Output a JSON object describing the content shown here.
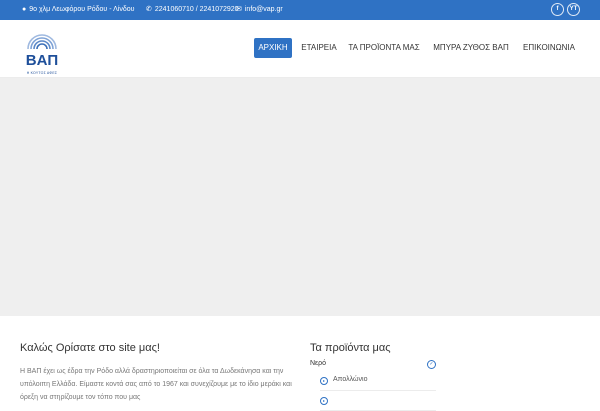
{
  "topbar": {
    "address": "9ο χλμ Λεωφόρου Ρόδου - Λίνδου",
    "phones": "2241060710 / 2241072920",
    "email": "info@vap.gr",
    "social": [
      {
        "icon": "facebook-icon",
        "label": "f"
      },
      {
        "icon": "youtube-icon",
        "label": "YT"
      }
    ]
  },
  "brand": {
    "name": "ΒΑΠ",
    "tagline": "Η ΚΟΥΤΟΣ ΑΦΕΣ",
    "color": "#2f72c4"
  },
  "nav": {
    "items": [
      {
        "label": "ΑΡΧΙΚΗ",
        "active": true
      },
      {
        "label": "ΕΤΑΙΡΕΙΑ",
        "active": false
      },
      {
        "label": "ΤΑ ΠΡΟΪΟΝΤΑ ΜΑΣ",
        "active": false
      },
      {
        "label": "ΜΠΥΡΑ ΖΥΘΟΣ ΒΑΠ",
        "active": false
      },
      {
        "label": "ΕΠΙΚΟΙΝΩΝΙΑ",
        "active": false
      }
    ]
  },
  "welcome": {
    "title": "Καλώς Ορίσατε στο site μας!",
    "text": "Η ΒΑΠ έχει ως έδρα την Ρόδο αλλά δραστηριοποιείται σε όλα τα Δωδεκάνησα και την υπόλοιπη Ελλάδα. Είμαστε κοντά σας από το 1967 και συνεχίζουμε με το ίδιο μεράκι και όρεξη να στηρίζουμε τον τόπο που μας"
  },
  "products": {
    "title": "Τα προϊόντα μας",
    "category": "Νερό",
    "items": [
      "Απολλώνιο"
    ]
  }
}
